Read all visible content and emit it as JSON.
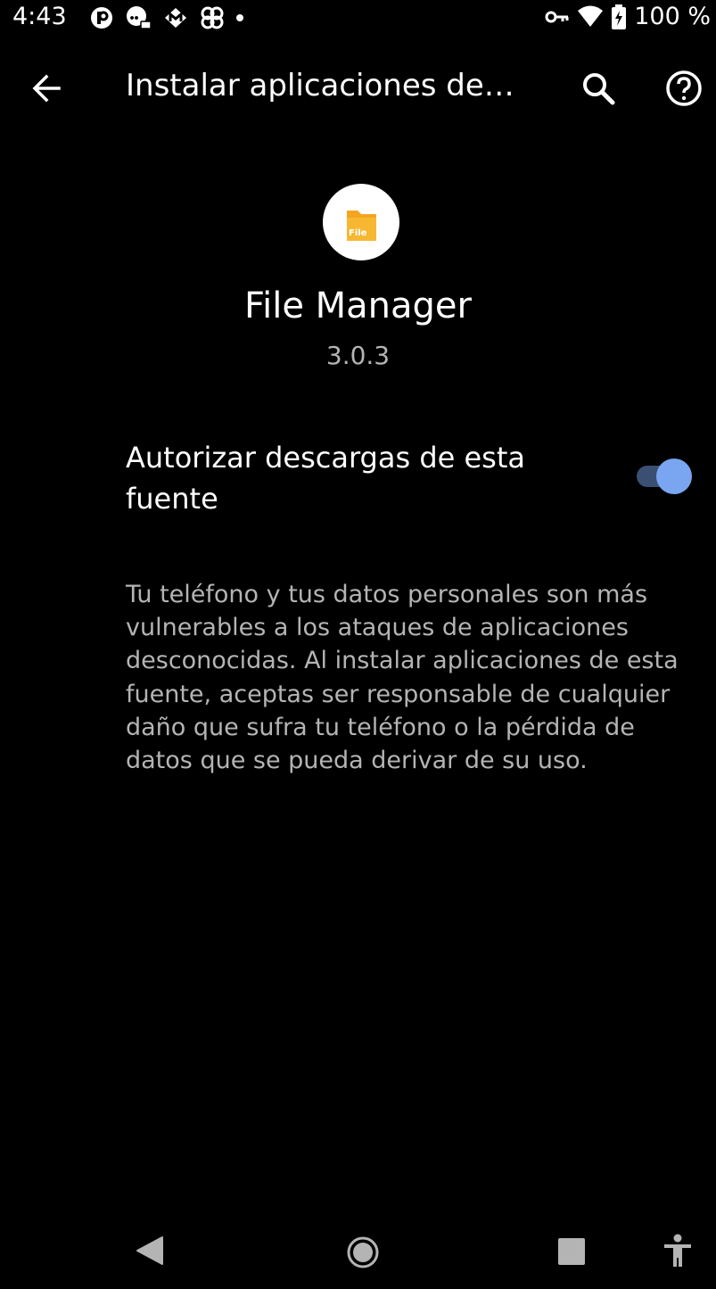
{
  "status_bar": {
    "time": "4:43",
    "battery": "100 %",
    "notification_icons": [
      "p-app-icon",
      "chat-bubble-icon",
      "m-app-icon",
      "pinwheel-icon",
      "dot-icon"
    ],
    "system_icons": [
      "vpn-key-icon",
      "wifi-icon",
      "battery-icon"
    ]
  },
  "app_bar": {
    "title": "Instalar aplicaciones de…",
    "back_icon": "arrow-back-icon",
    "search_icon": "search-icon",
    "help_icon": "help-icon"
  },
  "app_info": {
    "icon": "file-folder-icon",
    "icon_text": "File",
    "name": "File Manager",
    "version": "3.0.3"
  },
  "setting": {
    "label": "Autorizar descargas de esta fuente",
    "enabled": true
  },
  "warning": "Tu teléfono y tus datos personales son más vulnerables a los ataques de aplicaciones desconocidas. Al instalar aplicaciones de esta fuente, aceptas ser responsable de cualquier daño que sufra tu teléfono o la pérdida de datos que se pueda derivar de su uso.",
  "nav_bar": {
    "icons": [
      "nav-back-icon",
      "nav-home-icon",
      "nav-recents-icon",
      "accessibility-icon"
    ]
  },
  "colors": {
    "background": "#000000",
    "text_primary": "#ffffff",
    "text_secondary": "#b4b4b4",
    "switch_thumb": "#7aa5f0",
    "switch_track": "#3b4f73",
    "folder": "#f4a620"
  }
}
